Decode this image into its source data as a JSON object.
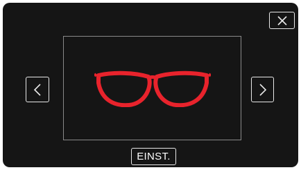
{
  "toolbar": {
    "close_icon": "close-icon"
  },
  "navigation": {
    "prev_icon": "chevron-left-icon",
    "next_icon": "chevron-right-icon"
  },
  "preview": {
    "icon": "glasses-icon",
    "icon_color": "#e8232c"
  },
  "actions": {
    "set_label": "EINST."
  },
  "colors": {
    "background": "#151515",
    "button_border": "#e9e9e9",
    "frame_border": "#8a8a8a"
  }
}
